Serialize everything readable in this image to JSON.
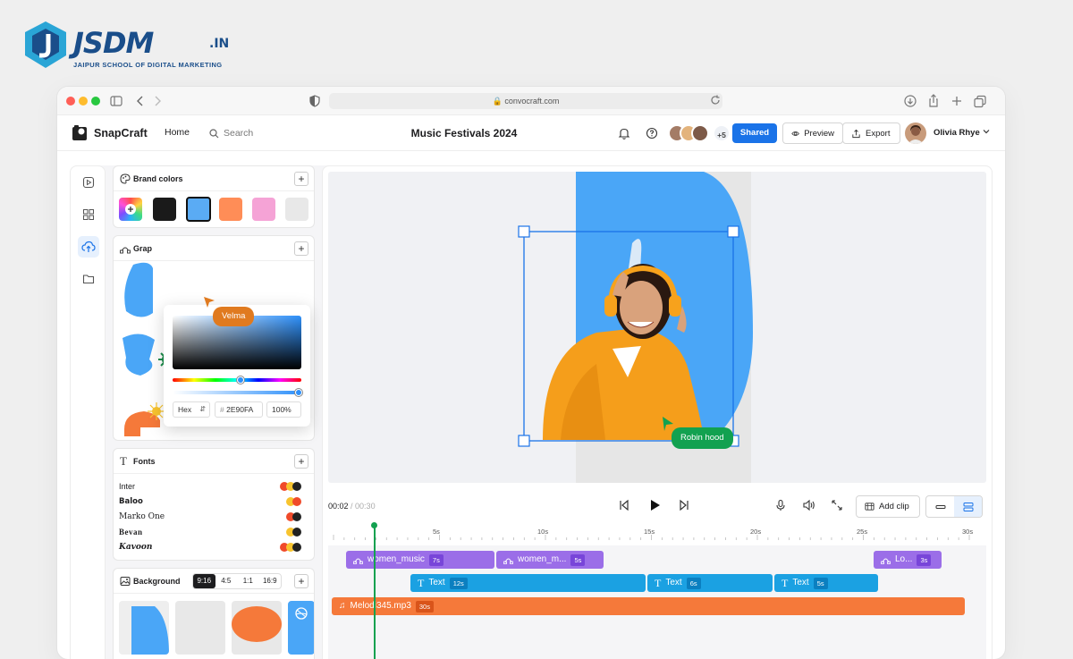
{
  "brand": {
    "word": "JSDM",
    "suffix": ".IN",
    "tagline": "JAIPUR SCHOOL OF DIGITAL MARKETING"
  },
  "browser": {
    "url": "convocraft.com"
  },
  "app": {
    "name": "SnapCraft",
    "home": "Home",
    "search": "Search",
    "document_title": "Music Festivals 2024",
    "more_collaborators": "+5",
    "shared": "Shared",
    "preview": "Preview",
    "export": "Export",
    "user": "Olivia Rhye"
  },
  "panels": {
    "brand_colors": {
      "title": "Brand colors",
      "swatches": [
        "#1a1a1a",
        "#5aabf4",
        "#ff8d57",
        "#f5a3d6",
        "#e8e8e8"
      ]
    },
    "graphics": {
      "title": "Grap"
    },
    "fonts": {
      "title": "Fonts",
      "items": [
        "Inter",
        "Baloo",
        "Marko One",
        "Bevan",
        "Kavoon"
      ]
    },
    "background": {
      "title": "Background",
      "ratios": [
        "9:16",
        "4:5",
        "1:1",
        "16:9"
      ],
      "selected_ratio": "9:16"
    }
  },
  "color_picker": {
    "mode": "Hex",
    "hex": "2E90FA",
    "opacity": "100%",
    "collaborator": "Velma"
  },
  "canvas": {
    "collaborator": "Robin hood"
  },
  "player": {
    "current": "00:02",
    "separator": " / ",
    "total": "00:30",
    "add_clip": "Add clip"
  },
  "timeline": {
    "ticks": [
      "5s",
      "10s",
      "15s",
      "20s",
      "25s",
      "30s"
    ],
    "video_clips": [
      {
        "label": "women_music",
        "dur": "7s"
      },
      {
        "label": "women_m...",
        "dur": "5s"
      },
      {
        "label": "Lo...",
        "dur": "3s"
      }
    ],
    "text_clips": [
      {
        "label": "Text",
        "dur": "12s"
      },
      {
        "label": "Text",
        "dur": "6s"
      },
      {
        "label": "Text",
        "dur": "5s"
      }
    ],
    "audio_clip": {
      "label": "Melodi345.mp3",
      "dur": "30s"
    }
  },
  "colors": {
    "accent": "#1a73e8",
    "video_clip": "#9b6ee8",
    "text_clip": "#1ba1e2",
    "audio_clip": "#f5793a",
    "cursor_green": "#12a150",
    "cursor_orange": "#e07a1f"
  }
}
